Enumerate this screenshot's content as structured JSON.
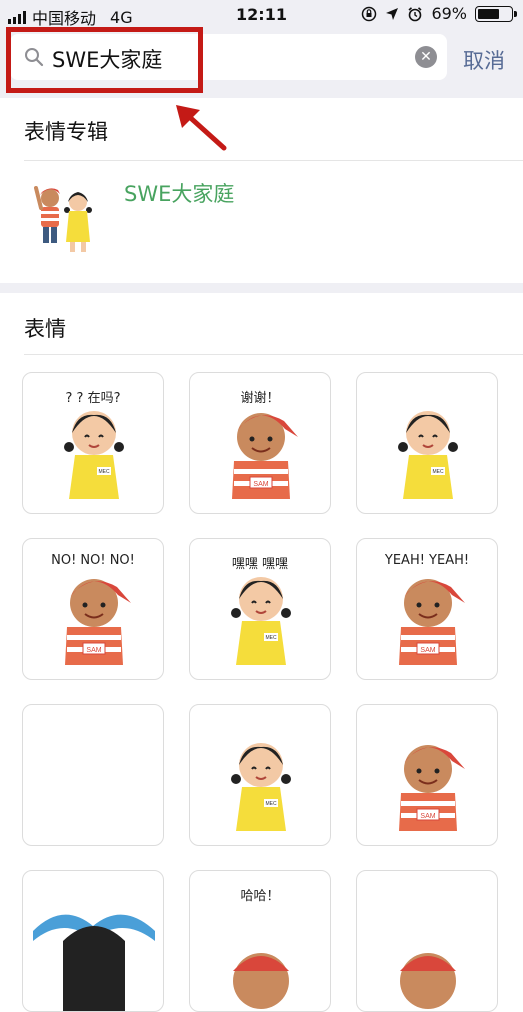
{
  "status_bar": {
    "carrier": "中国移动",
    "network": "4G",
    "time": "12:11",
    "battery": "69%",
    "battery_level": 0.69,
    "icons": [
      "signal-icon",
      "orientation-lock-icon",
      "location-icon",
      "alarm-icon",
      "battery-icon"
    ]
  },
  "search": {
    "query": "SWE大家庭",
    "cancel_label": "取消",
    "icons": [
      "search-icon",
      "clear-icon"
    ]
  },
  "annotation": {
    "highlight_color": "#c41a16",
    "icons": [
      "red-arrow-icon"
    ]
  },
  "album_section": {
    "title": "表情专辑",
    "items": [
      {
        "name": "SWE大家庭",
        "thumbnail": "sam-and-mec-thumbnail",
        "name_color": "#48a35f"
      }
    ]
  },
  "sticker_section": {
    "title": "表情",
    "stickers": [
      {
        "character": "mec",
        "caption": "? ? 在吗?"
      },
      {
        "character": "sam",
        "caption": "谢谢！"
      },
      {
        "character": "mec",
        "caption": ""
      },
      {
        "character": "sam",
        "caption": "NO! NO! NO!"
      },
      {
        "character": "mec",
        "caption": "嘿嘿 嘿嘿"
      },
      {
        "character": "sam",
        "caption": "YEAH! YEAH!"
      },
      {
        "character": "blank",
        "caption": ""
      },
      {
        "character": "mec",
        "caption": ""
      },
      {
        "character": "sam",
        "caption": ""
      },
      {
        "character": "partial",
        "caption": ""
      },
      {
        "character": "partial",
        "caption": "哈哈！"
      },
      {
        "character": "partial",
        "caption": ""
      }
    ]
  },
  "colors": {
    "background": "#efeff4",
    "link_blue": "#576b95",
    "green": "#48a35f"
  }
}
